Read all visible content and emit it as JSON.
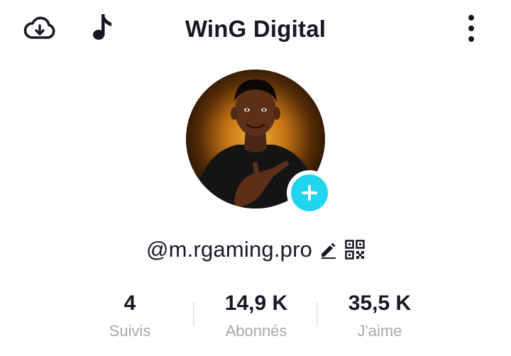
{
  "header": {
    "title": "WinG Digital",
    "icons": [
      "cloud-download-icon",
      "music-note-icon",
      "more-vertical-icon"
    ]
  },
  "profile": {
    "avatar": "profile-photo",
    "handle": "@m.rgaming.pro",
    "add_icon": "plus-icon",
    "accent_color": "#20d5ec"
  },
  "stats": [
    {
      "value": "4",
      "label": "Suivis"
    },
    {
      "value": "14,9 K",
      "label": "Abonnés"
    },
    {
      "value": "35,5 K",
      "label": "J'aime"
    }
  ]
}
